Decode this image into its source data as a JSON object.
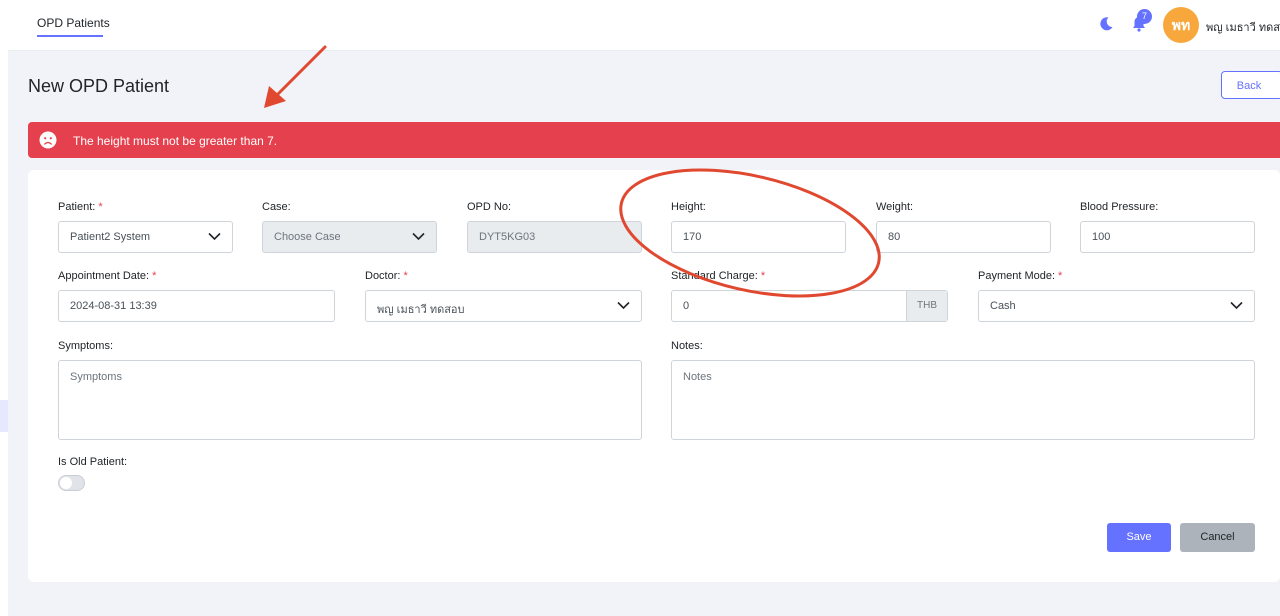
{
  "topbar": {
    "tab_label": "OPD Patients",
    "notification_count": "7",
    "avatar_initials": "พท",
    "user_name": "พญ เมธาวี ทดสอบ"
  },
  "page": {
    "title": "New OPD Patient",
    "back_label": "Back"
  },
  "alert": {
    "message": "The height must not be greater than 7."
  },
  "form": {
    "patient": {
      "label": "Patient:",
      "value": "Patient2 System"
    },
    "case": {
      "label": "Case:",
      "value": "Choose Case"
    },
    "opd_no": {
      "label": "OPD No:",
      "value": "DYT5KG03"
    },
    "height": {
      "label": "Height:",
      "value": "170"
    },
    "weight": {
      "label": "Weight:",
      "value": "80"
    },
    "blood_pressure": {
      "label": "Blood Pressure:",
      "value": "100"
    },
    "appointment_date": {
      "label": "Appointment Date:",
      "value": "2024-08-31 13:39"
    },
    "doctor": {
      "label": "Doctor:",
      "value": "พญ เมธาวี ทดสอบ"
    },
    "standard_charge": {
      "label": "Standard Charge:",
      "value": "0",
      "currency": "THB"
    },
    "payment_mode": {
      "label": "Payment Mode:",
      "value": "Cash"
    },
    "symptoms": {
      "label": "Symptoms:",
      "placeholder": "Symptoms"
    },
    "notes": {
      "label": "Notes:",
      "placeholder": "Notes"
    },
    "is_old_patient": {
      "label": "Is Old Patient:",
      "checked": false
    },
    "required_marker": "*",
    "save_label": "Save",
    "cancel_label": "Cancel"
  },
  "colors": {
    "primary": "#6571ff",
    "danger": "#e5404d",
    "annotation": "#e0482f",
    "avatar": "#f8a73c"
  }
}
